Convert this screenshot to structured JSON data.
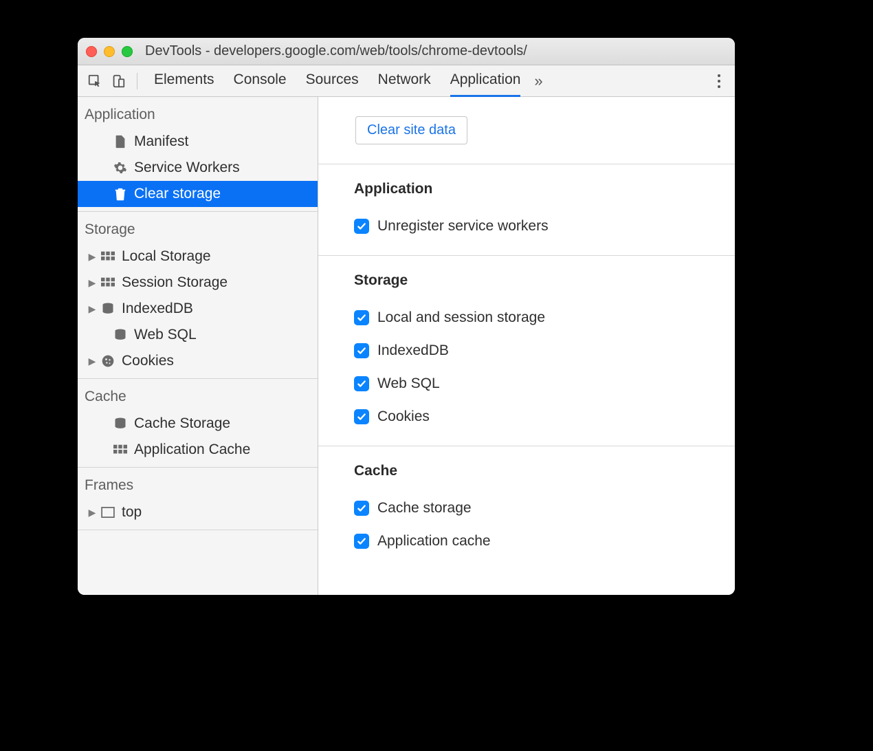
{
  "window": {
    "title": "DevTools - developers.google.com/web/tools/chrome-devtools/"
  },
  "toolbar": {
    "tabs": [
      "Elements",
      "Console",
      "Sources",
      "Network",
      "Application"
    ],
    "active_tab": "Application"
  },
  "sidebar": {
    "groups": [
      {
        "title": "Application",
        "items": [
          {
            "label": "Manifest",
            "icon": "document-icon",
            "expandable": false,
            "selected": false
          },
          {
            "label": "Service Workers",
            "icon": "gear-icon",
            "expandable": false,
            "selected": false
          },
          {
            "label": "Clear storage",
            "icon": "trash-icon",
            "expandable": false,
            "selected": true
          }
        ]
      },
      {
        "title": "Storage",
        "items": [
          {
            "label": "Local Storage",
            "icon": "grid-icon",
            "expandable": true,
            "selected": false
          },
          {
            "label": "Session Storage",
            "icon": "grid-icon",
            "expandable": true,
            "selected": false
          },
          {
            "label": "IndexedDB",
            "icon": "database-icon",
            "expandable": true,
            "selected": false
          },
          {
            "label": "Web SQL",
            "icon": "database-icon",
            "expandable": false,
            "selected": false
          },
          {
            "label": "Cookies",
            "icon": "cookie-icon",
            "expandable": true,
            "selected": false
          }
        ]
      },
      {
        "title": "Cache",
        "items": [
          {
            "label": "Cache Storage",
            "icon": "database-icon",
            "expandable": false,
            "selected": false
          },
          {
            "label": "Application Cache",
            "icon": "grid-icon",
            "expandable": false,
            "selected": false
          }
        ]
      },
      {
        "title": "Frames",
        "items": [
          {
            "label": "top",
            "icon": "frame-icon",
            "expandable": true,
            "selected": false
          }
        ]
      }
    ]
  },
  "main": {
    "clear_button": "Clear site data",
    "sections": [
      {
        "title": "Application",
        "items": [
          {
            "label": "Unregister service workers",
            "checked": true
          }
        ]
      },
      {
        "title": "Storage",
        "items": [
          {
            "label": "Local and session storage",
            "checked": true
          },
          {
            "label": "IndexedDB",
            "checked": true
          },
          {
            "label": "Web SQL",
            "checked": true
          },
          {
            "label": "Cookies",
            "checked": true
          }
        ]
      },
      {
        "title": "Cache",
        "items": [
          {
            "label": "Cache storage",
            "checked": true
          },
          {
            "label": "Application cache",
            "checked": true
          }
        ]
      }
    ]
  }
}
